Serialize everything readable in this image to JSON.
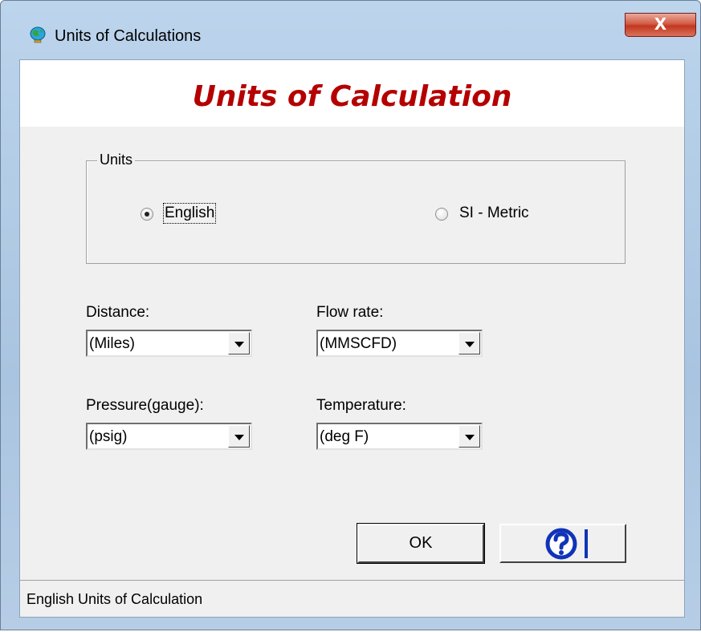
{
  "window": {
    "title": "Units of Calculations",
    "close_label": "X"
  },
  "header": {
    "title": "Units of Calculation"
  },
  "units_group": {
    "label": "Units",
    "options": [
      {
        "label": "English",
        "selected": true
      },
      {
        "label": "SI - Metric",
        "selected": false
      }
    ]
  },
  "fields": {
    "distance": {
      "label": "Distance:",
      "value": "(Miles)"
    },
    "flow_rate": {
      "label": "Flow rate:",
      "value": "(MMSCFD)"
    },
    "pressure": {
      "label": "Pressure(gauge):",
      "value": "(psig)"
    },
    "temperature": {
      "label": "Temperature:",
      "value": "(deg F)"
    }
  },
  "buttons": {
    "ok_label": "OK",
    "help_icon": "question-mark-icon"
  },
  "status": {
    "text": "English Units of Calculation"
  },
  "colors": {
    "header_title": "#b40000",
    "help_icon_blue": "#1033b8"
  }
}
